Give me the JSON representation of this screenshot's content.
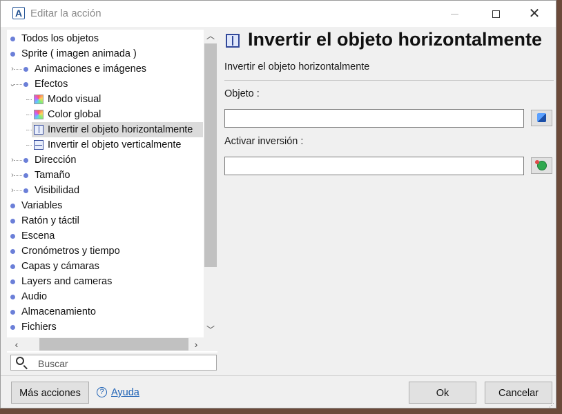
{
  "window": {
    "title": "Editar la acción",
    "app_icon_letter": "A",
    "minimize_icon": "minimize-icon",
    "maximize_icon": "maximize-icon",
    "close_icon": "close-icon"
  },
  "tree": {
    "items": [
      {
        "label": "Todos los objetos",
        "level": 0,
        "icon": "dot"
      },
      {
        "label": "Sprite ( imagen animada )",
        "level": 0,
        "icon": "dot"
      },
      {
        "label": "Animaciones e imágenes",
        "level": 1,
        "icon": "dot",
        "expander": ">"
      },
      {
        "label": "Efectos",
        "level": 1,
        "icon": "dot",
        "expander": "v"
      },
      {
        "label": "Modo visual",
        "level": 2,
        "icon": "color-palette-icon"
      },
      {
        "label": "Color global",
        "level": 2,
        "icon": "color-palette-icon"
      },
      {
        "label": "Invertir el objeto horizontalmente",
        "level": 2,
        "icon": "flip-horizontal-icon",
        "selected": true
      },
      {
        "label": "Invertir el objeto verticalmente",
        "level": 2,
        "icon": "flip-vertical-icon"
      },
      {
        "label": "Dirección",
        "level": 1,
        "icon": "dot",
        "expander": ">"
      },
      {
        "label": "Tamaño",
        "level": 1,
        "icon": "dot",
        "expander": ">"
      },
      {
        "label": "Visibilidad",
        "level": 1,
        "icon": "dot",
        "expander": ">"
      },
      {
        "label": "Variables",
        "level": 0,
        "icon": "dot"
      },
      {
        "label": "Ratón y táctil",
        "level": 0,
        "icon": "dot"
      },
      {
        "label": "Escena",
        "level": 0,
        "icon": "dot"
      },
      {
        "label": "Cronómetros y tiempo",
        "level": 0,
        "icon": "dot"
      },
      {
        "label": "Capas y cámaras",
        "level": 0,
        "icon": "dot"
      },
      {
        "label": "Layers and cameras",
        "level": 0,
        "icon": "dot"
      },
      {
        "label": "Audio",
        "level": 0,
        "icon": "dot"
      },
      {
        "label": "Almacenamiento",
        "level": 0,
        "icon": "dot"
      },
      {
        "label": "Fichiers",
        "level": 0,
        "icon": "dot"
      }
    ]
  },
  "search": {
    "placeholder": "Buscar"
  },
  "action": {
    "title": "Invertir el objeto horizontalmente",
    "description": "Invertir el objeto horizontalmente",
    "params": [
      {
        "label": "Objeto :",
        "value": "",
        "button_icon": "object-selector-icon"
      },
      {
        "label": "Activar inversión :",
        "value": "",
        "button_icon": "yes-no-selector-icon"
      }
    ]
  },
  "footer": {
    "more_actions": "Más acciones",
    "help": "Ayuda",
    "ok": "Ok",
    "cancel": "Cancelar"
  },
  "colors": {
    "bullet": "#6b7fd8",
    "selection": "#dbdbdb",
    "link": "#1a5fb4"
  }
}
